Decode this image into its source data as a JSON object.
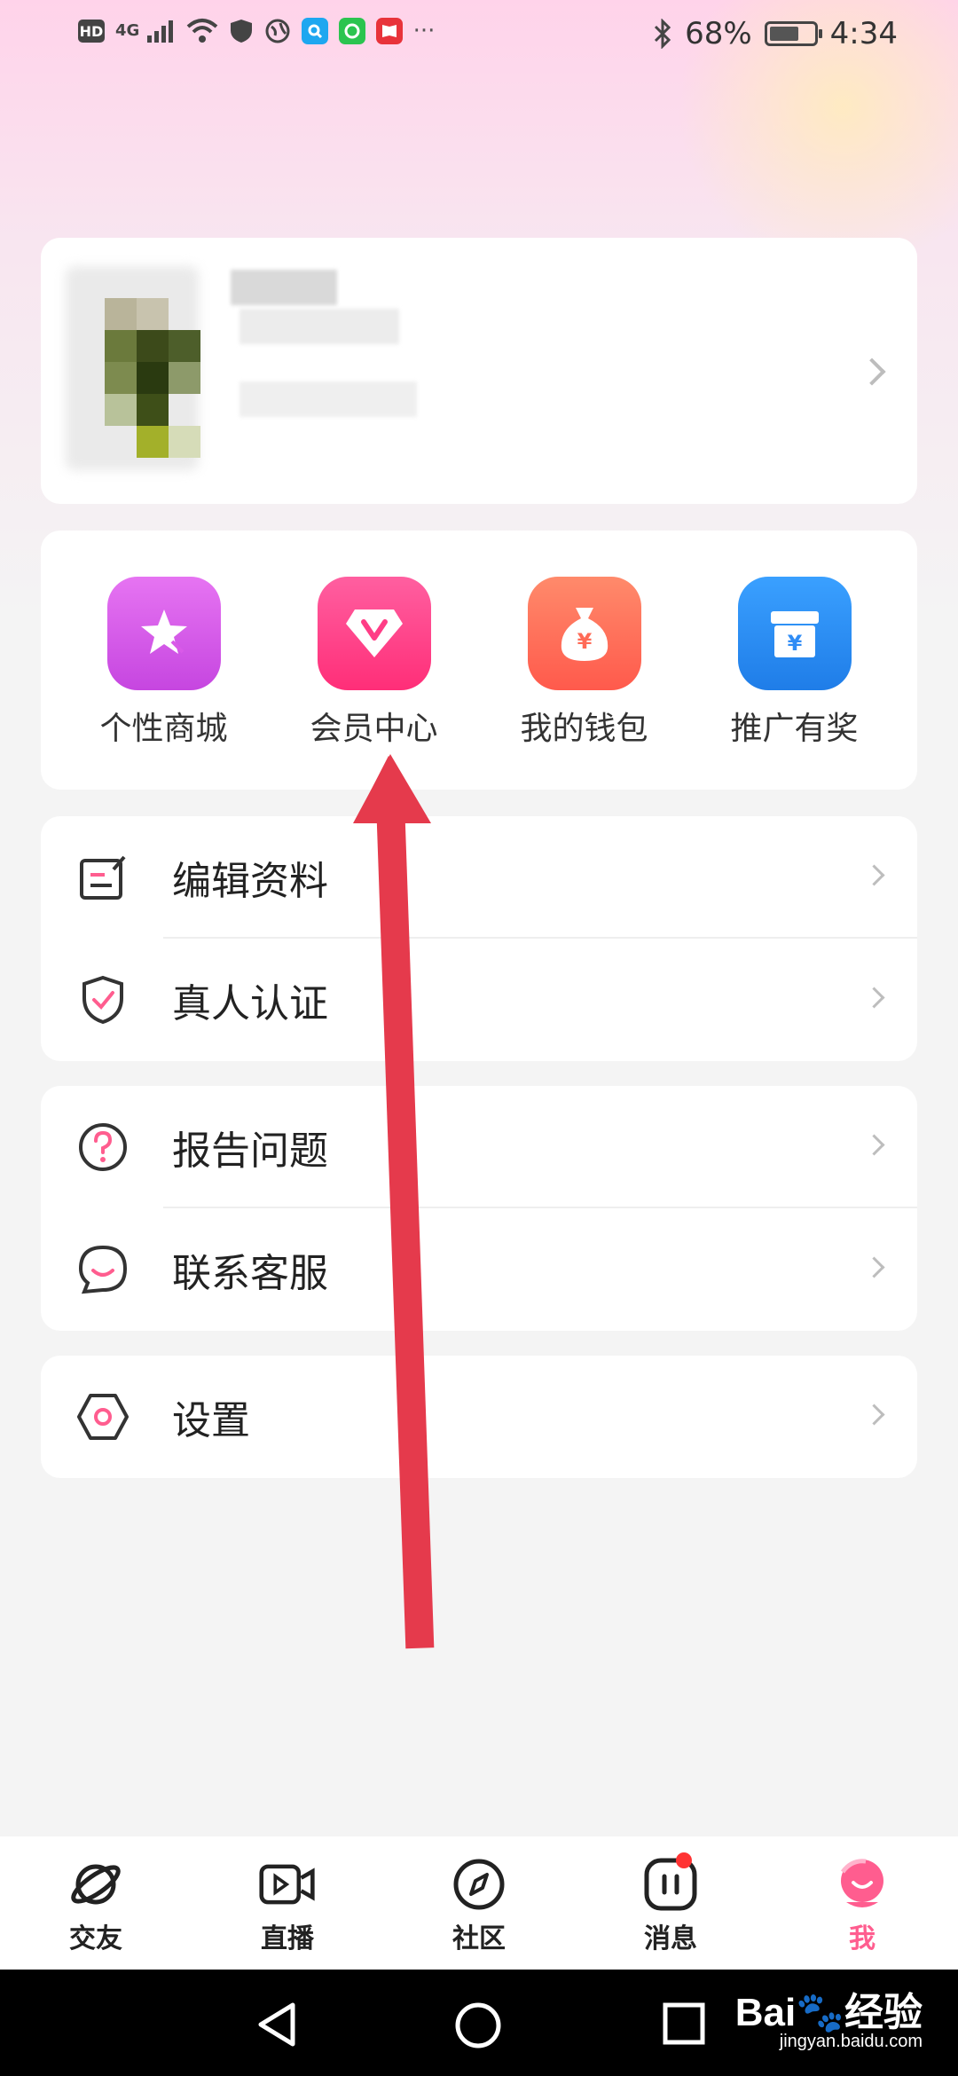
{
  "status_bar": {
    "left_icons": [
      "hd-icon",
      "signal-4g-icon",
      "wifi-icon",
      "shield-icon",
      "globe-icon",
      "search-app-icon",
      "chat-app-icon",
      "book-app-icon",
      "more-icon"
    ],
    "hd": "HD",
    "network": "4G",
    "more": "···",
    "battery": "68%",
    "battery_level": 0.68,
    "time": "4:34"
  },
  "profile": {
    "avatar": "blurred-avatar",
    "name_redacted": true
  },
  "shortcuts": [
    {
      "label": "个性商城",
      "icon": "star-icon",
      "color": "#d95ae8"
    },
    {
      "label": "会员中心",
      "icon": "diamond-v-icon",
      "color": "#ff3d86"
    },
    {
      "label": "我的钱包",
      "icon": "money-bag-icon",
      "color": "#ff6b57"
    },
    {
      "label": "推广有奖",
      "icon": "gift-box-icon",
      "color": "#2f8cf5"
    }
  ],
  "menu_group_1": [
    {
      "label": "编辑资料",
      "icon": "edit-icon"
    },
    {
      "label": "真人认证",
      "icon": "shield-check-icon"
    }
  ],
  "menu_group_2": [
    {
      "label": "报告问题",
      "icon": "question-icon"
    },
    {
      "label": "联系客服",
      "icon": "support-icon"
    }
  ],
  "menu_group_3": [
    {
      "label": "设置",
      "icon": "settings-icon"
    }
  ],
  "tabbar": {
    "items": [
      {
        "label": "交友",
        "icon": "planet-icon"
      },
      {
        "label": "直播",
        "icon": "video-icon"
      },
      {
        "label": "社区",
        "icon": "compass-icon"
      },
      {
        "label": "消息",
        "icon": "message-icon"
      },
      {
        "label": "我",
        "icon": "profile-face-icon"
      }
    ],
    "active_index": 4,
    "accent": "#ff5d8f"
  },
  "watermark": {
    "brand": "Bai",
    "suffix": "经验",
    "url": "jingyan.baidu.com"
  }
}
